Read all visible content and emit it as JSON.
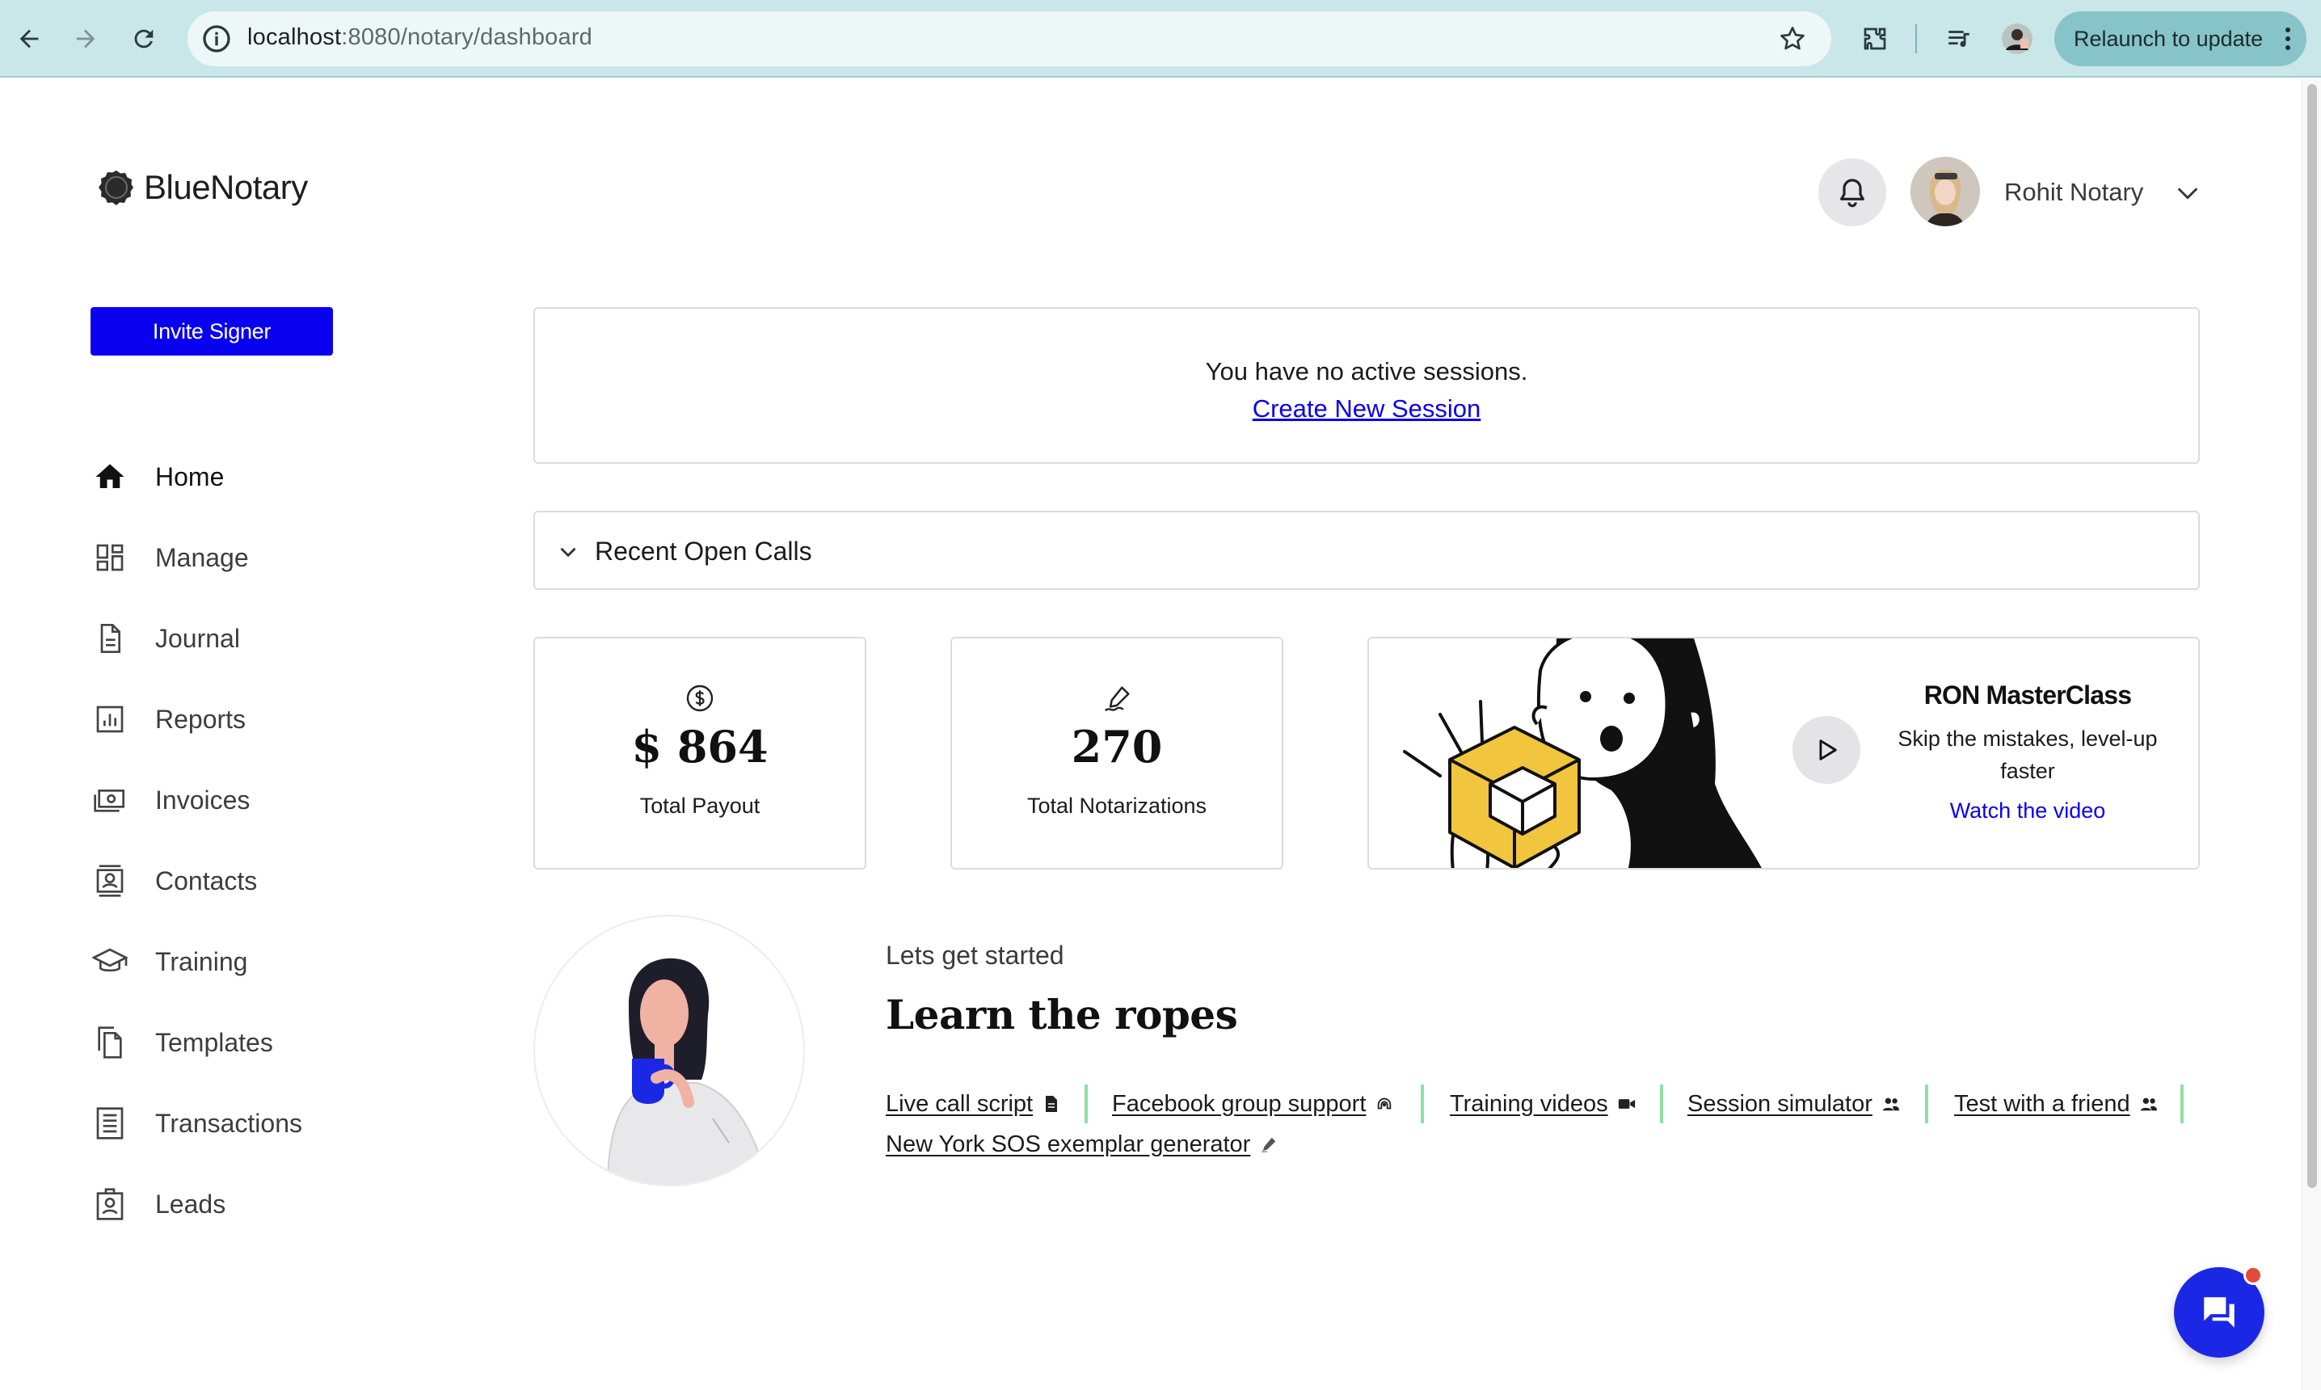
{
  "browser": {
    "url_host": "localhost",
    "url_rest": ":8080/notary/dashboard",
    "relaunch_label": "Relaunch to update"
  },
  "brand": {
    "name": "BlueNotary"
  },
  "header": {
    "user_name": "Rohit Notary"
  },
  "sidebar": {
    "invite_label": "Invite Signer",
    "items": [
      {
        "label": "Home",
        "icon": "home-icon",
        "active": true
      },
      {
        "label": "Manage",
        "icon": "dashboard-grid-icon"
      },
      {
        "label": "Journal",
        "icon": "document-icon"
      },
      {
        "label": "Reports",
        "icon": "bar-chart-icon"
      },
      {
        "label": "Invoices",
        "icon": "payments-icon"
      },
      {
        "label": "Contacts",
        "icon": "contacts-icon"
      },
      {
        "label": "Training",
        "icon": "graduation-cap-icon"
      },
      {
        "label": "Templates",
        "icon": "copy-file-icon"
      },
      {
        "label": "Transactions",
        "icon": "receipt-icon"
      },
      {
        "label": "Leads",
        "icon": "badge-id-icon"
      }
    ]
  },
  "sessions": {
    "message": "You have no active sessions.",
    "create_link": "Create New Session"
  },
  "recent_calls": {
    "label": "Recent Open Calls"
  },
  "stats": {
    "payout": {
      "value": "$ 864",
      "label": "Total Payout",
      "icon": "dollar-circle-icon"
    },
    "notarizations": {
      "value": "270",
      "label": "Total Notarizations",
      "icon": "signature-pen-icon"
    }
  },
  "masterclass": {
    "title": "RON MasterClass",
    "description": "Skip the mistakes, level-up faster",
    "link": "Watch the video"
  },
  "ropes": {
    "eyebrow": "Lets get started",
    "title": "Learn the ropes",
    "links": [
      {
        "label": "Live call script",
        "icon": "document-small-icon"
      },
      {
        "label": "Facebook group support",
        "icon": "support-icon"
      },
      {
        "label": "Training videos",
        "icon": "video-camera-icon"
      },
      {
        "label": "Session simulator",
        "icon": "people-icon"
      },
      {
        "label": "Test with a friend",
        "icon": "people-icon"
      },
      {
        "label": "New York SOS exemplar generator",
        "icon": "pen-icon"
      }
    ]
  },
  "colors": {
    "accent": "#0a00f0",
    "separator": "#8fe0a0",
    "chrome": "#c9e6e8",
    "chat": "#1a28e6",
    "notification": "#e24b3b"
  }
}
